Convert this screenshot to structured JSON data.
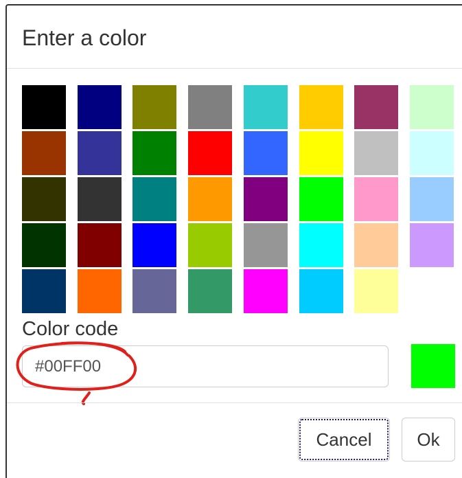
{
  "dialog": {
    "title": "Enter a color",
    "color_code_label": "Color code",
    "color_code_value": "#00FF00",
    "preview_color": "#00FF00",
    "cancel_label": "Cancel",
    "ok_label": "Ok"
  },
  "palette": [
    [
      "#000000",
      "#000080",
      "#808000",
      "#808080",
      "#33CCCC",
      "#FFCC00",
      "#993366",
      "#CCFFCC"
    ],
    [
      "#993300",
      "#333399",
      "#008000",
      "#FF0000",
      "#3366FF",
      "#FFFF00",
      "#C0C0C0",
      "#CCFFFF"
    ],
    [
      "#333300",
      "#333333",
      "#008080",
      "#FF9900",
      "#800080",
      "#00FF00",
      "#FF99CC",
      "#99CCFF"
    ],
    [
      "#003300",
      "#800000",
      "#0000FF",
      "#99CC00",
      "#969696",
      "#00FFFF",
      "#FFCC99",
      "#CC99FF"
    ],
    [
      "#003366",
      "#FF6600",
      "#666699",
      "#339966",
      "#FF00FF",
      "#00CCFF",
      "#FFFF99"
    ]
  ],
  "annotation": {
    "color": "#E0201B",
    "shape": "hand-drawn-circle-around-color-code"
  }
}
